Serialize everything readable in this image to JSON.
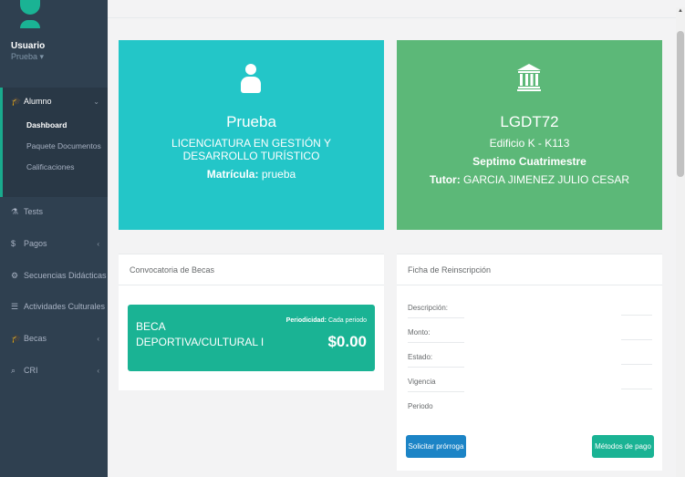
{
  "user": {
    "name": "Usuario",
    "role": "Prueba ▾"
  },
  "sidebar": {
    "alumno": {
      "label": "Alumno",
      "icon": "graduation-cap-icon"
    },
    "sub": [
      "Dashboard",
      "Paquete Documentos",
      "Calificaciones"
    ],
    "items": [
      {
        "label": "Tests",
        "icon": "flask-icon"
      },
      {
        "label": "Pagos",
        "icon": "dollar-icon"
      },
      {
        "label": "Secuencias Didácticas",
        "icon": "gears-icon"
      },
      {
        "label": "Actividades Culturales",
        "icon": "list-icon"
      },
      {
        "label": "Becas",
        "icon": "graduation-cap-icon"
      },
      {
        "label": "CRI",
        "icon": "search-icon"
      }
    ]
  },
  "student_card": {
    "name": "Prueba",
    "program": "LICENCIATURA EN GESTIÓN Y DESARROLLO TURÍSTICO",
    "matricula_label": "Matrícula:",
    "matricula_value": "prueba",
    "color": "#23c6c8"
  },
  "group_card": {
    "group": "LGDT72",
    "building": "Edificio K - K113",
    "term": "Septimo Cuatrimestre",
    "tutor_label": "Tutor:",
    "tutor_value": "GARCIA JIMENEZ JULIO CESAR",
    "color": "#5cb878"
  },
  "becas_panel": {
    "title": "Convocatoria de Becas",
    "beca_name": "BECA DEPORTIVA/CULTURAL I",
    "periodicidad_label": "Periodicidad:",
    "periodicidad_value": "Cada periodo",
    "amount": "$0.00"
  },
  "ficha_panel": {
    "title": "Ficha de Reinscripción",
    "rows": [
      "Descripción:",
      "Monto:",
      "Estado:",
      "Vigencia",
      "Periodo"
    ],
    "btn_prorroga": "Solicitar prórroga",
    "btn_metodos": "Métodos de pago"
  }
}
